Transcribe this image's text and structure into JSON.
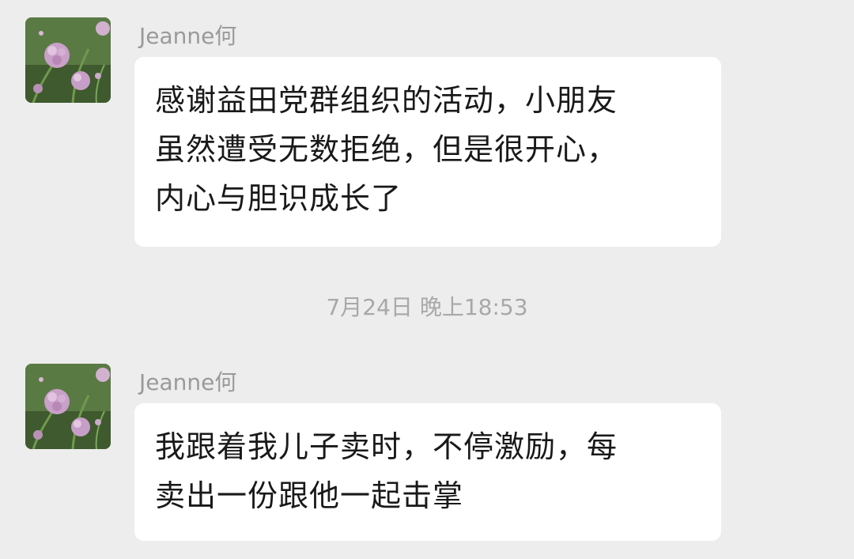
{
  "messages": [
    {
      "sender": "Jeanne何",
      "avatar_icon": "flower-avatar-icon",
      "lines": [
        "感谢益田党群组织的活动，小朋友",
        "虽然遭受无数拒绝，但是很开心，",
        "内心与胆识成长了"
      ]
    },
    {
      "sender": "Jeanne何",
      "avatar_icon": "flower-avatar-icon",
      "lines": [
        "我跟着我儿子卖时，不停激励，每",
        "卖出一份跟他一起击掌"
      ]
    }
  ],
  "timestamp": "7月24日 晚上18:53",
  "colors": {
    "background": "#ededed",
    "bubble": "#ffffff",
    "sender_text": "#9a9a9a",
    "timestamp_text": "#a8a8a8",
    "message_text": "#191919"
  }
}
